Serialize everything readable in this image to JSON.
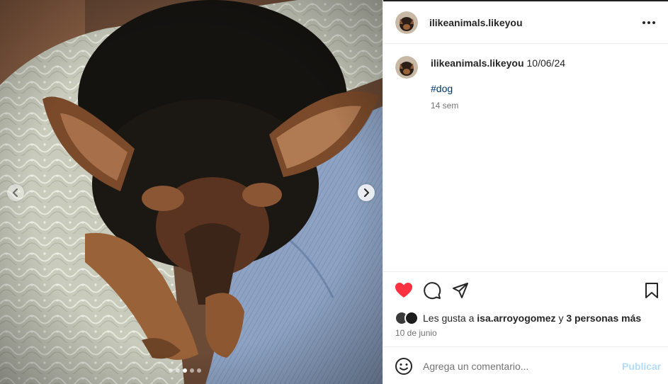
{
  "post": {
    "username": "ilikeanimals.likeyou",
    "more_icon": "more-horizontal-icon"
  },
  "caption": {
    "username": "ilikeanimals.likeyou",
    "date": "10/06/24",
    "hashtag": "#dog",
    "time_ago": "14 sem"
  },
  "carousel": {
    "total_slides": 5,
    "current_slide": 3,
    "prev_icon": "chevron-left-icon",
    "next_icon": "chevron-right-icon"
  },
  "actions": {
    "liked": true,
    "like_color": "#ff3040",
    "like_icon": "heart-filled-icon",
    "comment_icon": "comment-icon",
    "share_icon": "send-icon",
    "save_icon": "bookmark-icon"
  },
  "likes": {
    "prefix": "Les gusta a",
    "user": "isa.arroyogomez",
    "connector": "y",
    "others": "3 personas más"
  },
  "post_date": "10 de junio",
  "comment_box": {
    "placeholder": "Agrega un comentario...",
    "value": "",
    "publish_label": "Publicar",
    "publish_color": "#b3dbff",
    "emoji_icon": "smiley-icon"
  }
}
